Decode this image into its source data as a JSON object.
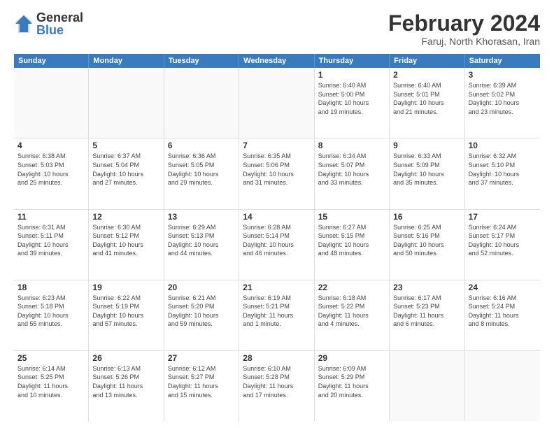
{
  "logo": {
    "general": "General",
    "blue": "Blue"
  },
  "title": "February 2024",
  "subtitle": "Faruj, North Khorasan, Iran",
  "header_days": [
    "Sunday",
    "Monday",
    "Tuesday",
    "Wednesday",
    "Thursday",
    "Friday",
    "Saturday"
  ],
  "weeks": [
    [
      {
        "day": "",
        "info": ""
      },
      {
        "day": "",
        "info": ""
      },
      {
        "day": "",
        "info": ""
      },
      {
        "day": "",
        "info": ""
      },
      {
        "day": "1",
        "info": "Sunrise: 6:40 AM\nSunset: 5:00 PM\nDaylight: 10 hours\nand 19 minutes."
      },
      {
        "day": "2",
        "info": "Sunrise: 6:40 AM\nSunset: 5:01 PM\nDaylight: 10 hours\nand 21 minutes."
      },
      {
        "day": "3",
        "info": "Sunrise: 6:39 AM\nSunset: 5:02 PM\nDaylight: 10 hours\nand 23 minutes."
      }
    ],
    [
      {
        "day": "4",
        "info": "Sunrise: 6:38 AM\nSunset: 5:03 PM\nDaylight: 10 hours\nand 25 minutes."
      },
      {
        "day": "5",
        "info": "Sunrise: 6:37 AM\nSunset: 5:04 PM\nDaylight: 10 hours\nand 27 minutes."
      },
      {
        "day": "6",
        "info": "Sunrise: 6:36 AM\nSunset: 5:05 PM\nDaylight: 10 hours\nand 29 minutes."
      },
      {
        "day": "7",
        "info": "Sunrise: 6:35 AM\nSunset: 5:06 PM\nDaylight: 10 hours\nand 31 minutes."
      },
      {
        "day": "8",
        "info": "Sunrise: 6:34 AM\nSunset: 5:07 PM\nDaylight: 10 hours\nand 33 minutes."
      },
      {
        "day": "9",
        "info": "Sunrise: 6:33 AM\nSunset: 5:09 PM\nDaylight: 10 hours\nand 35 minutes."
      },
      {
        "day": "10",
        "info": "Sunrise: 6:32 AM\nSunset: 5:10 PM\nDaylight: 10 hours\nand 37 minutes."
      }
    ],
    [
      {
        "day": "11",
        "info": "Sunrise: 6:31 AM\nSunset: 5:11 PM\nDaylight: 10 hours\nand 39 minutes."
      },
      {
        "day": "12",
        "info": "Sunrise: 6:30 AM\nSunset: 5:12 PM\nDaylight: 10 hours\nand 41 minutes."
      },
      {
        "day": "13",
        "info": "Sunrise: 6:29 AM\nSunset: 5:13 PM\nDaylight: 10 hours\nand 44 minutes."
      },
      {
        "day": "14",
        "info": "Sunrise: 6:28 AM\nSunset: 5:14 PM\nDaylight: 10 hours\nand 46 minutes."
      },
      {
        "day": "15",
        "info": "Sunrise: 6:27 AM\nSunset: 5:15 PM\nDaylight: 10 hours\nand 48 minutes."
      },
      {
        "day": "16",
        "info": "Sunrise: 6:25 AM\nSunset: 5:16 PM\nDaylight: 10 hours\nand 50 minutes."
      },
      {
        "day": "17",
        "info": "Sunrise: 6:24 AM\nSunset: 5:17 PM\nDaylight: 10 hours\nand 52 minutes."
      }
    ],
    [
      {
        "day": "18",
        "info": "Sunrise: 6:23 AM\nSunset: 5:18 PM\nDaylight: 10 hours\nand 55 minutes."
      },
      {
        "day": "19",
        "info": "Sunrise: 6:22 AM\nSunset: 5:19 PM\nDaylight: 10 hours\nand 57 minutes."
      },
      {
        "day": "20",
        "info": "Sunrise: 6:21 AM\nSunset: 5:20 PM\nDaylight: 10 hours\nand 59 minutes."
      },
      {
        "day": "21",
        "info": "Sunrise: 6:19 AM\nSunset: 5:21 PM\nDaylight: 11 hours\nand 1 minute."
      },
      {
        "day": "22",
        "info": "Sunrise: 6:18 AM\nSunset: 5:22 PM\nDaylight: 11 hours\nand 4 minutes."
      },
      {
        "day": "23",
        "info": "Sunrise: 6:17 AM\nSunset: 5:23 PM\nDaylight: 11 hours\nand 6 minutes."
      },
      {
        "day": "24",
        "info": "Sunrise: 6:16 AM\nSunset: 5:24 PM\nDaylight: 11 hours\nand 8 minutes."
      }
    ],
    [
      {
        "day": "25",
        "info": "Sunrise: 6:14 AM\nSunset: 5:25 PM\nDaylight: 11 hours\nand 10 minutes."
      },
      {
        "day": "26",
        "info": "Sunrise: 6:13 AM\nSunset: 5:26 PM\nDaylight: 11 hours\nand 13 minutes."
      },
      {
        "day": "27",
        "info": "Sunrise: 6:12 AM\nSunset: 5:27 PM\nDaylight: 11 hours\nand 15 minutes."
      },
      {
        "day": "28",
        "info": "Sunrise: 6:10 AM\nSunset: 5:28 PM\nDaylight: 11 hours\nand 17 minutes."
      },
      {
        "day": "29",
        "info": "Sunrise: 6:09 AM\nSunset: 5:29 PM\nDaylight: 11 hours\nand 20 minutes."
      },
      {
        "day": "",
        "info": ""
      },
      {
        "day": "",
        "info": ""
      }
    ]
  ]
}
